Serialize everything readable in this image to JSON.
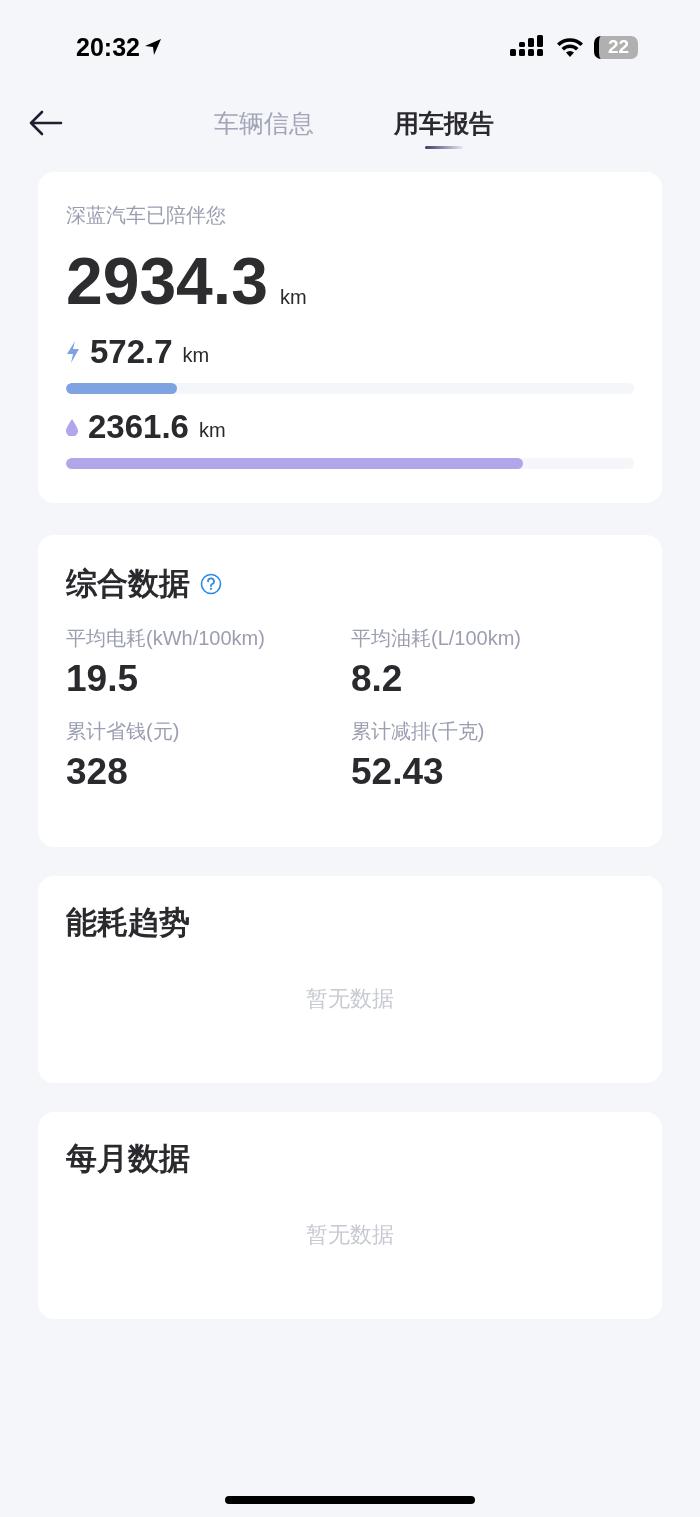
{
  "status_bar": {
    "time": "20:32",
    "battery": "22"
  },
  "tabs": [
    {
      "label": "车辆信息",
      "selected": false
    },
    {
      "label": "用车报告",
      "selected": true
    }
  ],
  "mileage": {
    "title": "深蓝汽车已陪伴您",
    "total": "2934.3",
    "unit": "km",
    "bars": [
      {
        "kind": "electric",
        "value": "572.7",
        "unit": "km",
        "level": 0.195,
        "color": "#7fa3e0"
      },
      {
        "kind": "fuel",
        "value": "2361.6",
        "unit": "km",
        "level": 0.805,
        "color": "#b3a5ea"
      }
    ]
  },
  "summary": {
    "title": "综合数据",
    "stats": [
      {
        "label": "平均电耗(kWh/100km)",
        "value": "19.5"
      },
      {
        "label": "平均油耗(L/100km)",
        "value": "8.2"
      },
      {
        "label": "累计省钱(元)",
        "value": "328"
      },
      {
        "label": "累计减排(千克)",
        "value": "52.43"
      }
    ]
  },
  "sections": [
    {
      "title": "能耗趋势",
      "empty": "暂无数据"
    },
    {
      "title": "每月数据",
      "empty": "暂无数据"
    }
  ]
}
